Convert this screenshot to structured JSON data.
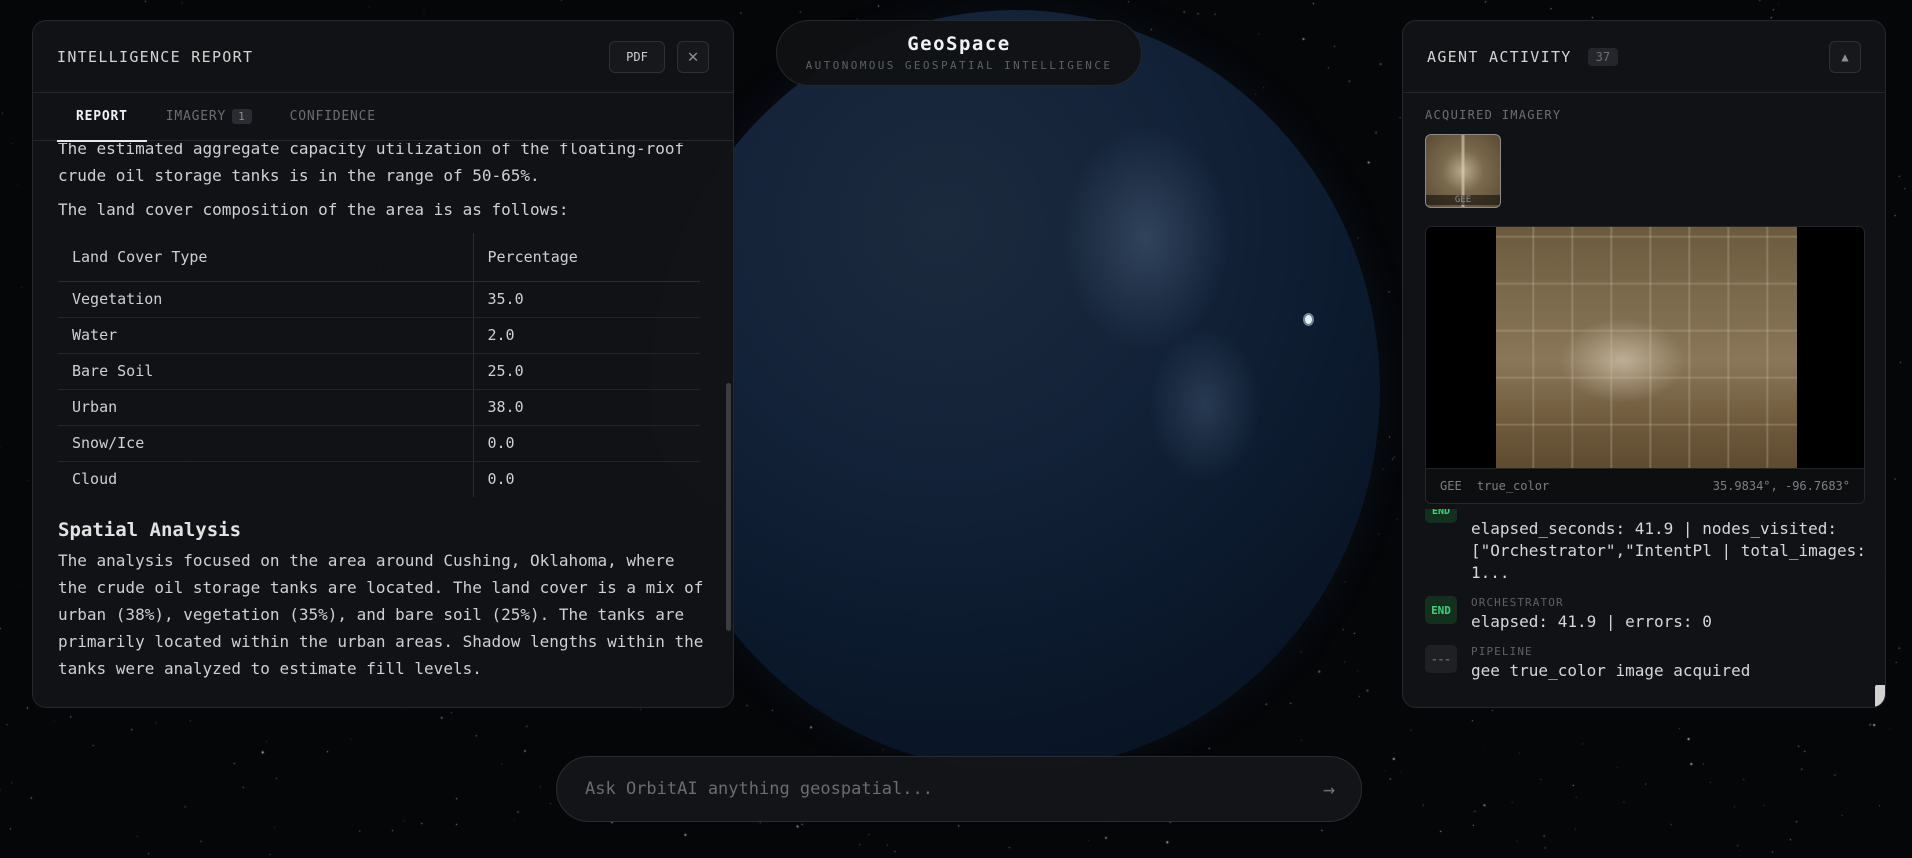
{
  "header": {
    "brand": "GeoSpace",
    "tagline": "AUTONOMOUS GEOSPATIAL INTELLIGENCE"
  },
  "report_panel": {
    "title": "INTELLIGENCE REPORT",
    "pdf_label": "PDF",
    "close_icon": "close-icon",
    "tabs": [
      {
        "label": "REPORT",
        "badge": ""
      },
      {
        "label": "IMAGERY",
        "badge": "1"
      },
      {
        "label": "CONFIDENCE",
        "badge": ""
      }
    ],
    "intro_text": "The estimated aggregate capacity utilization of the floating-roof crude oil storage tanks is in the range of 50-65%.",
    "land_cover_intro": "The land cover composition of the area is as follows:",
    "land_cover_table": {
      "headers": [
        "Land Cover Type",
        "Percentage"
      ],
      "rows": [
        [
          "Vegetation",
          "35.0"
        ],
        [
          "Water",
          "2.0"
        ],
        [
          "Bare Soil",
          "25.0"
        ],
        [
          "Urban",
          "38.0"
        ],
        [
          "Snow/Ice",
          "0.0"
        ],
        [
          "Cloud",
          "0.0"
        ]
      ]
    },
    "section_heading": "Spatial Analysis",
    "section_text": "The analysis focused on the area around Cushing, Oklahoma, where the crude oil storage tanks are located. The land cover is a mix of urban (38%), vegetation (35%), and bare soil (25%). The tanks are primarily located within the urban areas. Shadow lengths within the tanks were analyzed to estimate fill levels."
  },
  "activity_panel": {
    "title": "AGENT ACTIVITY",
    "count": "37",
    "collapse_icon": "triangle-up-icon",
    "acquired_label": "ACQUIRED IMAGERY",
    "thumb_label": "GEE",
    "viewer": {
      "source": "GEE",
      "product": "true_color",
      "coords": "35.9834°, -96.7683°"
    },
    "logs": [
      {
        "chip": "END",
        "meta": "",
        "text": "elapsed_seconds: 41.9 | nodes_visited: [\"Orchestrator\",\"IntentPl | total_images: 1..."
      },
      {
        "chip": "END",
        "meta": "ORCHESTRATOR",
        "text": "elapsed: 41.9 | errors: 0"
      },
      {
        "chip": "---",
        "meta": "PIPELINE",
        "text": "gee true_color image acquired"
      }
    ]
  },
  "query": {
    "placeholder": "Ask OrbitAI anything geospatial...",
    "send_icon": "arrow-right-icon"
  },
  "colors": {
    "background": "#050608",
    "panel": "#121316",
    "accent_green": "#3fd07a",
    "globe": "#0c1a2e"
  }
}
